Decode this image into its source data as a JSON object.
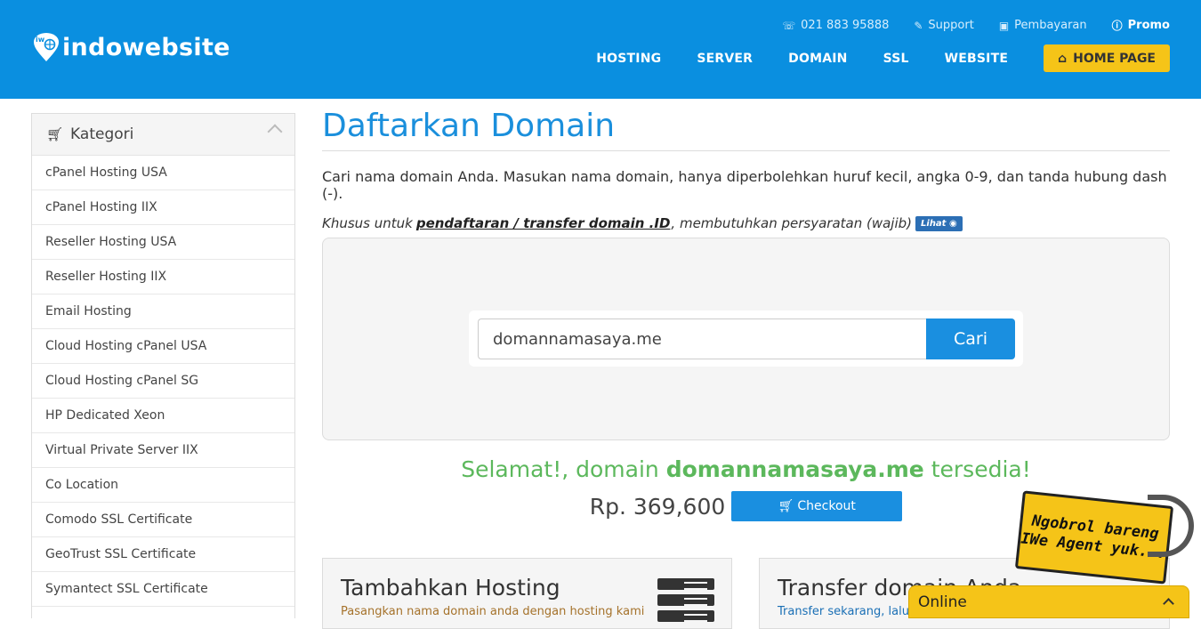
{
  "brand": {
    "name": "indowebsite",
    "badge": "iw"
  },
  "topbar": {
    "phone": "021 883 95888",
    "support": "Support",
    "payment": "Pembayaran",
    "promo": "Promo"
  },
  "nav": {
    "items": [
      "HOSTING",
      "SERVER",
      "DOMAIN",
      "SSL",
      "WEBSITE"
    ],
    "home": "HOME PAGE"
  },
  "sidebar": {
    "title": "Kategori",
    "items": [
      "cPanel Hosting USA",
      "cPanel Hosting IIX",
      "Reseller Hosting USA",
      "Reseller Hosting IIX",
      "Email Hosting",
      "Cloud Hosting cPanel USA",
      "Cloud Hosting cPanel SG",
      "HP Dedicated Xeon",
      "Virtual Private Server IIX",
      "Co Location",
      "Comodo SSL Certificate",
      "GeoTrust SSL Certificate",
      "Symantect SSL Certificate"
    ]
  },
  "main": {
    "title": "Daftarkan Domain",
    "lead": "Cari nama domain Anda. Masukan nama domain, hanya diperbolehkan huruf kecil, angka 0-9, dan tanda hubung dash (-).",
    "note_prefix": "Khusus untuk",
    "note_link": "pendaftaran / transfer domain .ID",
    "note_suffix": ", membutuhkan persyaratan (wajib)",
    "lihat": "Lihat",
    "search_value": "domannamasaya.me",
    "search_button": "Cari",
    "result_prefix": "Selamat!, domain",
    "result_domain": "domannamasaya.me",
    "result_suffix": "tersedia!",
    "price": "Rp. 369,600",
    "checkout": "Checkout"
  },
  "cards": [
    {
      "title": "Tambahkan Hosting",
      "sub": "Pasangkan nama domain anda dengan hosting kami"
    },
    {
      "title": "Transfer domain Anda",
      "sub": "Transfer sekarang, lalu"
    }
  ],
  "chat": {
    "status": "Online",
    "bubble_line1": "Ngobrol bareng",
    "bubble_line2": "IWe Agent yuk..."
  },
  "colors": {
    "primary": "#0a8fe0",
    "accent": "#f5c418",
    "success": "#5cb85c"
  }
}
